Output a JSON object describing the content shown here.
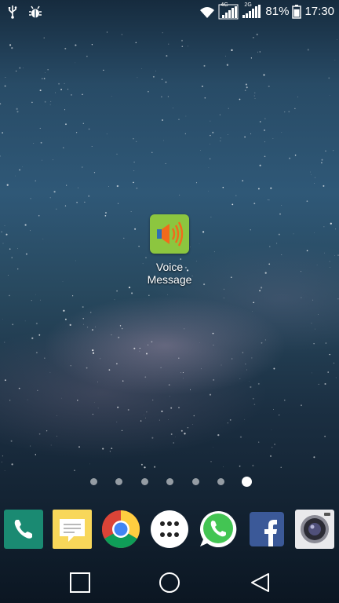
{
  "status_bar": {
    "left_icons": [
      "usb-icon",
      "debug-bug-icon"
    ],
    "wifi_icon": "wifi-icon",
    "sim1_network": "4G",
    "sim2_network": "2G",
    "battery_percent": "81%",
    "battery_level": 0.81,
    "time": "17:30"
  },
  "home": {
    "app": {
      "label": "Voice\nMessage",
      "icon": "speaker-icon",
      "color": "#8cc63f"
    },
    "page_indicator": {
      "pages": 7,
      "current": 7
    }
  },
  "dock": {
    "apps": [
      {
        "name": "phone",
        "icon": "phone-icon"
      },
      {
        "name": "messaging",
        "icon": "message-icon"
      },
      {
        "name": "chrome",
        "icon": "chrome-icon"
      },
      {
        "name": "app-drawer",
        "icon": "apps-grid-icon"
      },
      {
        "name": "whatsapp",
        "icon": "whatsapp-icon"
      },
      {
        "name": "facebook",
        "icon": "facebook-icon"
      },
      {
        "name": "camera",
        "icon": "camera-icon"
      }
    ]
  },
  "nav_bar": {
    "buttons": [
      "recents-icon",
      "home-icon",
      "back-icon"
    ]
  }
}
